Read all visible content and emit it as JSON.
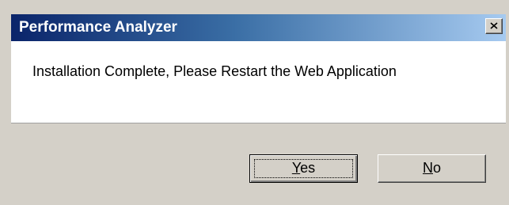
{
  "window": {
    "title": "Performance Analyzer",
    "close_icon": "close-icon"
  },
  "message": {
    "text": "Installation Complete, Please Restart the Web Application"
  },
  "buttons": {
    "yes": {
      "mnemonic": "Y",
      "rest": "es",
      "is_default": true
    },
    "no": {
      "mnemonic": "N",
      "rest": "o",
      "is_default": false
    }
  },
  "colors": {
    "title_gradient_start": "#0a246a",
    "title_gradient_end": "#a6caf0",
    "face": "#d4d0c8",
    "message_background": "#ffffff"
  }
}
